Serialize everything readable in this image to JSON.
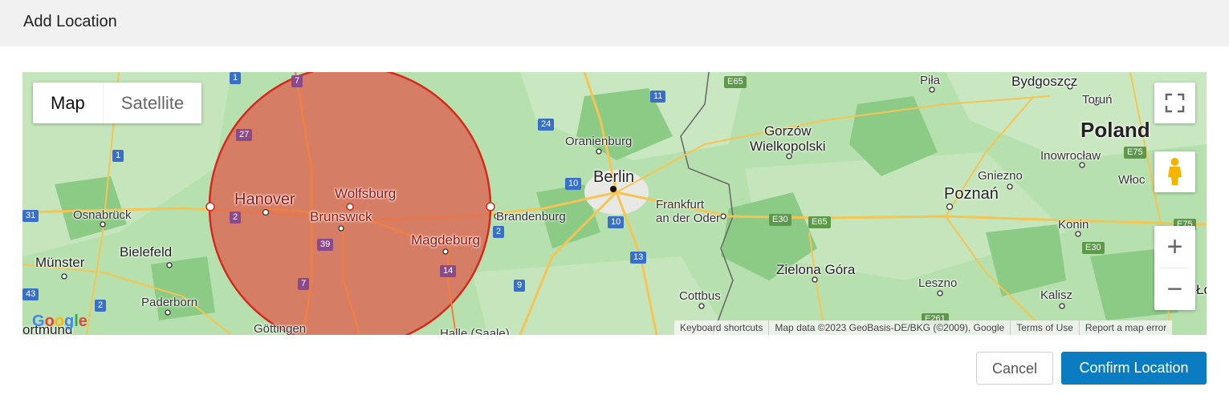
{
  "dialog": {
    "title": "Add Location"
  },
  "map": {
    "type_toggle": {
      "map": "Map",
      "satellite": "Satellite",
      "selected": "Map"
    },
    "cities": {
      "hanover": "Hanover",
      "wolfsburg": "Wolfsburg",
      "brunswick": "Brunswick",
      "magdeburg": "Magdeburg",
      "berlin": "Berlin",
      "oranienburg": "Oranienburg",
      "brandenburg": "Brandenburg",
      "frankfurt_oder": "Frankfurt\nan der Oder",
      "gorzow": "Gorzów\nWielkopolski",
      "poznan": "Poznań",
      "pila": "Piła",
      "bydgoszcz": "Bydgoszcz",
      "torun": "Toruń",
      "inowroclaw": "Inowrocław",
      "gniezno": "Gniezno",
      "wloclawek": "Włoc",
      "konin": "Konin",
      "kalisz": "Kalisz",
      "leszno": "Leszno",
      "zielona_gora": "Zielona Góra",
      "cottbus": "Cottbus",
      "osnabruck": "Osnabrück",
      "bielefeld": "Bielefeld",
      "munster": "Münster",
      "paderborn": "Paderborn",
      "gottingen": "Göttingen",
      "dortmund": "ortmund",
      "halle": "Halle (Saale)",
      "lodz": "Łó"
    },
    "country_label": "Poland",
    "road_shields": {
      "a7_top": "7",
      "a27": "27",
      "a1_a": "1",
      "a1_b": "1",
      "a2": "2",
      "a2b": "2",
      "a31": "31",
      "a39": "39",
      "a7": "7",
      "a14": "14",
      "a43": "43",
      "a24": "24",
      "a11": "11",
      "a10a": "10",
      "a10b": "10",
      "a13": "13",
      "a9": "9",
      "a2c": "2",
      "e65_top": "E65",
      "e30": "E30",
      "e65": "E65",
      "e75": "E75",
      "e75b": "E75",
      "e30b": "E30",
      "e261": "E261"
    },
    "radius_circle": {
      "fill_color": "#e0584a",
      "stroke_color": "#d42a1e"
    },
    "controls": {
      "fullscreen_icon": "fullscreen-icon",
      "pegman_icon": "pegman-icon",
      "zoom_in": "+",
      "zoom_out": "−"
    },
    "attribution": {
      "keyboard": "Keyboard shortcuts",
      "map_data": "Map data ©2023 GeoBasis-DE/BKG (©2009), Google",
      "terms": "Terms of Use",
      "report": "Report a map error"
    },
    "logo": "Google"
  },
  "footer": {
    "cancel_label": "Cancel",
    "confirm_label": "Confirm Location",
    "confirm_color": "#0a7dc2"
  }
}
